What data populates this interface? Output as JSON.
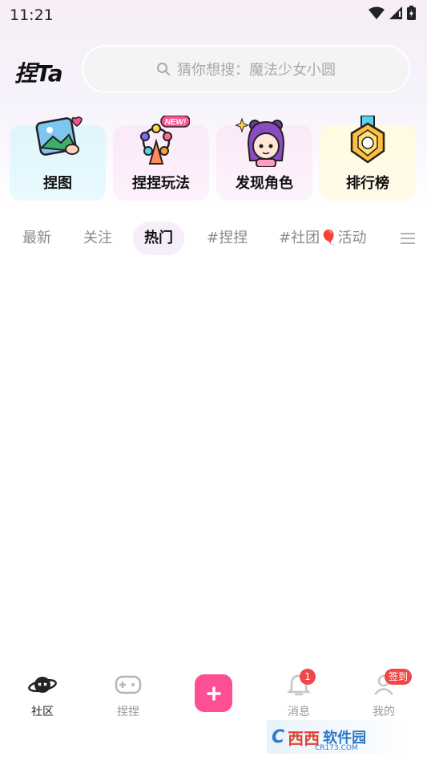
{
  "status_bar": {
    "time": "11:21"
  },
  "header": {
    "logo_text": "捏Ta",
    "search_placeholder": "猜你想搜：魔法少女小圆"
  },
  "feature_cards": [
    {
      "label": "捏图",
      "icon": "picture-frame-icon"
    },
    {
      "label": "捏捏玩法",
      "icon": "ferris-wheel-icon",
      "badge": "NEW!"
    },
    {
      "label": "发现角色",
      "icon": "character-avatar-icon"
    },
    {
      "label": "排行榜",
      "icon": "medal-icon"
    }
  ],
  "tabs": [
    {
      "label": "最新",
      "active": false
    },
    {
      "label": "关注",
      "active": false
    },
    {
      "label": "热门",
      "active": true
    },
    {
      "label": "#捏捏",
      "active": false
    },
    {
      "label": "#社团🎈活动",
      "active": false
    }
  ],
  "bottom_nav": [
    {
      "label": "社区",
      "icon": "planet-icon",
      "active": true
    },
    {
      "label": "捏捏",
      "icon": "gamepad-icon",
      "active": false
    },
    {
      "label": "消息",
      "icon": "bell-icon",
      "active": false,
      "badge": "1"
    },
    {
      "label": "我的",
      "icon": "profile-icon",
      "active": false,
      "badge": "签到"
    }
  ],
  "watermark": {
    "brand": "西西",
    "text": "软件园",
    "url_text": "CR173.COM"
  },
  "colors": {
    "accent": "#ff4f94",
    "badge": "#f04848",
    "active_tab_bg": "#f6eef8"
  }
}
